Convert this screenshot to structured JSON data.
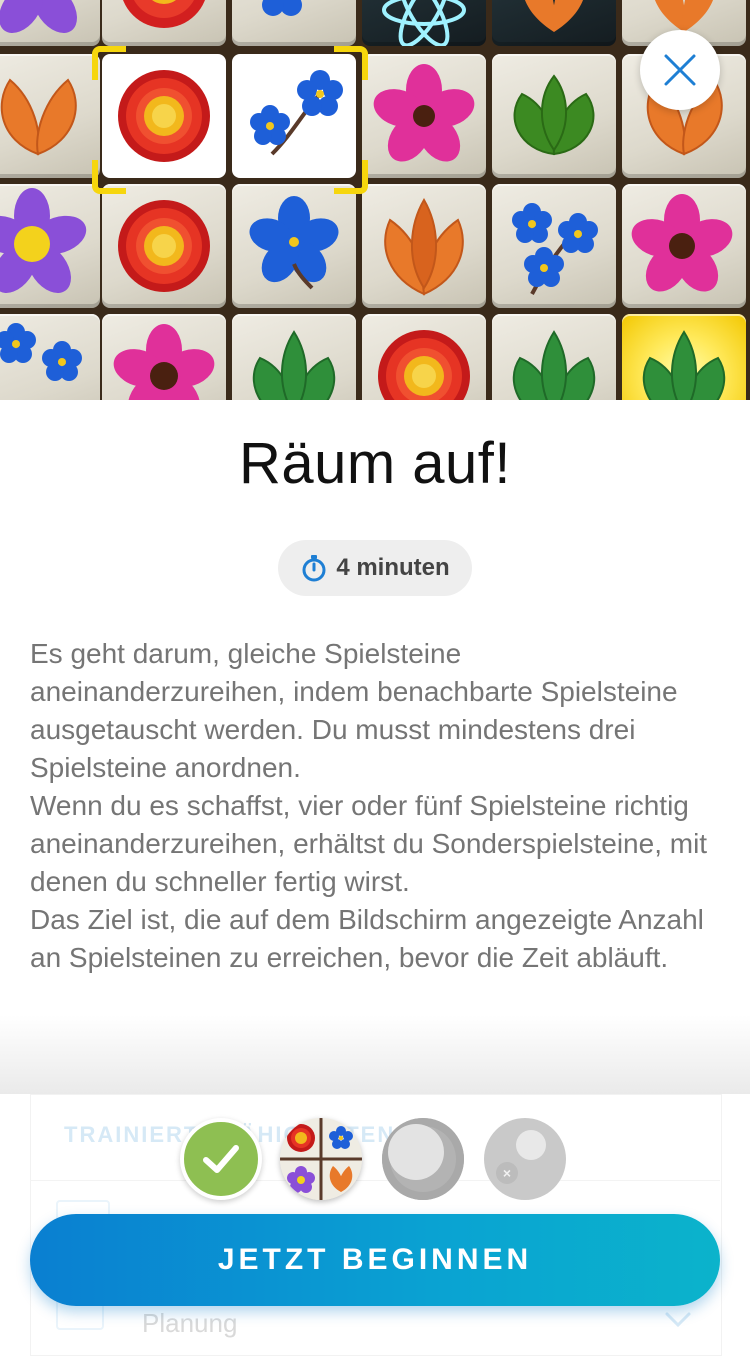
{
  "game": {
    "title": "Räum auf!",
    "duration_label": "4 minuten",
    "description": [
      "Es geht darum, gleiche Spielsteine aneinanderzureihen, indem benachbarte Spielsteine ausgetauscht werden. Du musst mindestens drei Spielsteine anordnen.",
      "Wenn du es schaffst, vier oder fünf Spielsteine richtig aneinanderzureihen, erhältst du Sonderspielsteine, mit denen du schneller fertig wirst.",
      "Das Ziel ist, die auf dem Bildschirm angezeigte Anzahl an Spielsteinen zu erreichen, bevor die Zeit abläuft."
    ]
  },
  "preview": {
    "icons": {
      "close": "close-icon",
      "timer": "stopwatch-icon"
    },
    "tile_kinds": [
      "purple-flower",
      "red-daisy",
      "blue-forget-me-not",
      "pink-flower",
      "orange-leaves",
      "green-leaves",
      "atom-special",
      "glow-special"
    ]
  },
  "sheet": {
    "section_label": "TRAINIERTE FÄHIGKEITEN",
    "skill_label": "Planung"
  },
  "progress": {
    "steps": [
      {
        "state": "completed",
        "icon": "checkmark-icon"
      },
      {
        "state": "current",
        "icon": "game-thumbnail-icon"
      },
      {
        "state": "locked",
        "icon": "empty-circle-icon"
      },
      {
        "state": "locked",
        "icon": "bubbles-icon"
      }
    ]
  },
  "cta": {
    "label": "JETZT BEGINNEN"
  },
  "colors": {
    "accent_blue": "#0a7fd1",
    "accent_cyan": "#0bb3cb",
    "completed_green": "#8ebf52",
    "selection_yellow": "#f6d60d",
    "close_icon_blue": "#1e7fd4"
  }
}
